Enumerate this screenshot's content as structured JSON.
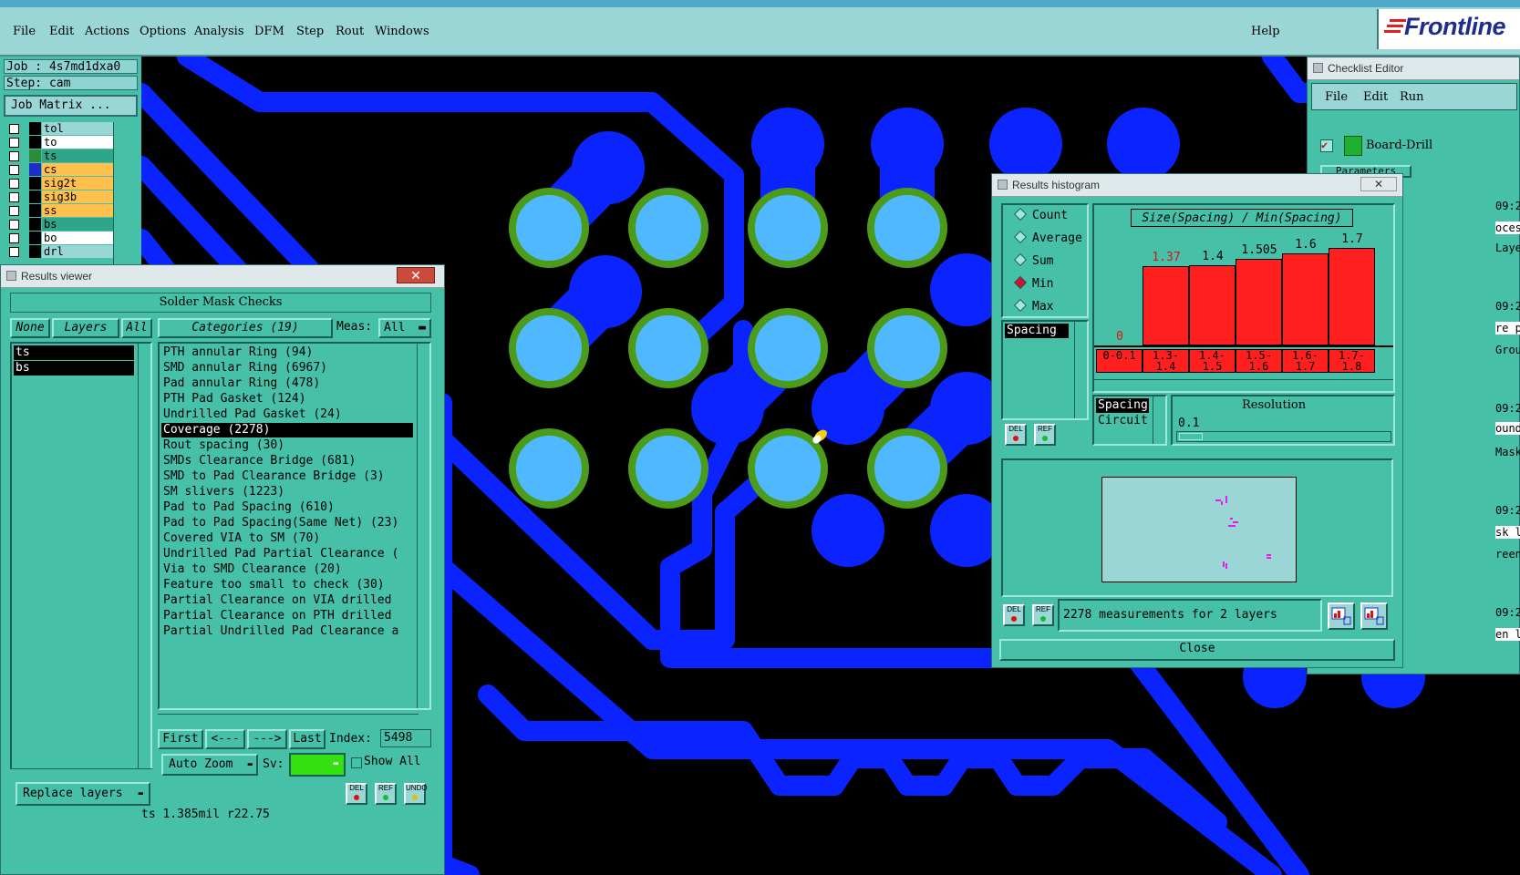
{
  "menubar": {
    "items": [
      "File",
      "Edit",
      "Actions",
      "Options",
      "Analysis",
      "DFM",
      "Step",
      "Rout",
      "Windows"
    ],
    "help": "Help",
    "logo": "Frontline"
  },
  "leftpanel": {
    "job": "Job : 4s7md1dxa0",
    "step": "Step: cam",
    "job_matrix": "Job Matrix ...",
    "layers": [
      {
        "name": "tol",
        "color": "#000000",
        "bg": "#9ad6d6"
      },
      {
        "name": "to",
        "color": "#000000",
        "bg": "#ffffff"
      },
      {
        "name": "ts",
        "color": "#2e8b3a",
        "bg": "#2fa58a"
      },
      {
        "name": "cs",
        "color": "#1e2cc8",
        "bg": "#ffc04d"
      },
      {
        "name": "sig2t",
        "color": "#000000",
        "bg": "#ffc04d"
      },
      {
        "name": "sig3b",
        "color": "#000000",
        "bg": "#ffc04d"
      },
      {
        "name": "ss",
        "color": "#000000",
        "bg": "#ffc04d"
      },
      {
        "name": "bs",
        "color": "#000000",
        "bg": "#2fa58a"
      },
      {
        "name": "bo",
        "color": "#000000",
        "bg": "#ffffff"
      },
      {
        "name": "drl",
        "color": "#000000",
        "bg": "#9ad6d6"
      }
    ]
  },
  "results_viewer": {
    "title": "Results viewer",
    "header": "Solder Mask Checks",
    "none_btn": "None",
    "layers_btn": "Layers",
    "all_btn": "All",
    "layer_list": [
      "ts",
      "bs"
    ],
    "categories_label": "Categories (19)",
    "meas_label": "Meas:",
    "meas_value": "All",
    "categories": [
      "PTH annular Ring (94)",
      "SMD annular Ring (6967)",
      "Pad annular Ring (478)",
      "PTH Pad Gasket (124)",
      "Undrilled Pad Gasket (24)",
      "Coverage (2278)",
      "Rout spacing (30)",
      "SMDs Clearance Bridge (681)",
      "SMD to Pad Clearance Bridge (3)",
      "SM slivers (1223)",
      "Pad to Pad Spacing (610)",
      "Pad to Pad Spacing(Same Net) (23)",
      "Covered VIA to SM (70)",
      "Undrilled Pad Partial Clearance (",
      "Via to SMD Clearance (20)",
      "Feature too small to check (30)",
      "Partial Clearance on VIA drilled",
      "Partial Clearance on PTH drilled",
      "Partial Undrilled Pad Clearance a"
    ],
    "nav": {
      "first": "First",
      "prev": "<---",
      "next": "--->",
      "last": "Last",
      "index_label": "Index:",
      "index_value": "5498"
    },
    "auto_zoom": "Auto Zoom",
    "sv_label": "Sv:",
    "show_all": "Show All",
    "replace_layers": "Replace layers",
    "del": "DEL",
    "ref": "REF",
    "undo": "UNDO"
  },
  "status": "ts 1.385mil  r22.75",
  "checklist_editor": {
    "title": "Checklist Editor",
    "menus": [
      "File",
      "Edit",
      "Run"
    ],
    "item": "Board-Drill",
    "params": "Parameters",
    "side_texts": [
      "09:2",
      "oces",
      "Laye",
      "09:2",
      "re p",
      "Grou",
      "09:2",
      "ound",
      "Mask",
      "09:2",
      "sk l",
      "reen",
      "09:2",
      "en l"
    ]
  },
  "histogram": {
    "title": "Results histogram",
    "modes": [
      "Count",
      "Average",
      "Sum",
      "Min",
      "Max"
    ],
    "selected_mode": "Min",
    "list": [
      "Spacing"
    ],
    "chart_title": "Size(Spacing) / Min(Spacing)",
    "spacing_list": [
      "Spacing",
      "Circuit"
    ],
    "resolution_label": "Resolution",
    "resolution_value": "0.1",
    "measurements": "2278 measurements for 2 layers",
    "close": "Close",
    "del": "DEL",
    "ref": "REF"
  },
  "chart_data": {
    "type": "bar",
    "title": "Size(Spacing) / Min(Spacing)",
    "categories": [
      "0-0.1",
      "1.3-1.4",
      "1.4-1.5",
      "1.5-1.6",
      "1.6-1.7",
      "1.7-1.8"
    ],
    "values": [
      0,
      1.37,
      1.4,
      1.505,
      1.6,
      1.7
    ],
    "labels": [
      "0",
      "1.37",
      "1.4",
      "1.505",
      "1.6",
      "1.7"
    ],
    "ylim": [
      0,
      1.9
    ],
    "bar_color": "#ff1f1f"
  }
}
